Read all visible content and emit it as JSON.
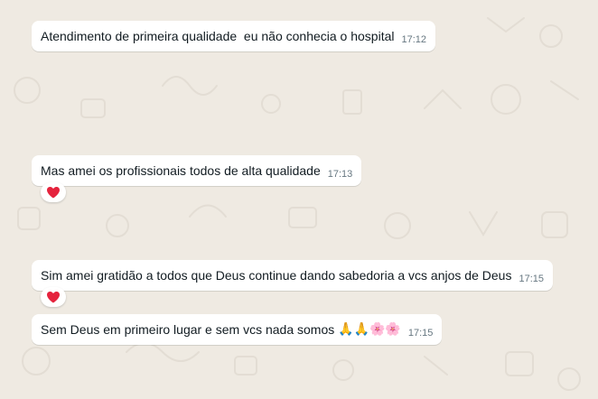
{
  "messages": [
    {
      "text": "Atendimento de primeira qualidade  eu não conhecia o hospital",
      "time": "17:12"
    },
    {
      "text": "Mas amei os profissionais todos de alta qualidade",
      "time": "17:13",
      "reaction": "heart"
    },
    {
      "text": "Sim amei gratidão a todos que Deus continue dando sabedoria a vcs anjos de Deus",
      "time": "17:15",
      "reaction": "heart"
    },
    {
      "text": "Sem Deus em primeiro lugar e sem vcs nada somos ",
      "emoji": "🙏🙏🌸🌸",
      "time": "17:15"
    }
  ],
  "colors": {
    "background": "#efeae2",
    "bubble": "#ffffff",
    "text": "#111b21",
    "timestamp": "#667781",
    "heart": "#e5233d"
  },
  "icons": [
    "heart-reaction-icon"
  ]
}
